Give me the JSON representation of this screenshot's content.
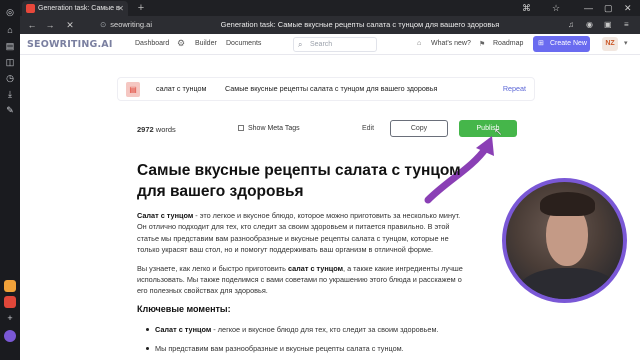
{
  "browser": {
    "tab_title": "Generation task: Самые в",
    "new_tab": "+",
    "url": "seowriting.ai",
    "page_title": "Generation task: Самые вкусные рецепты салата с тунцом для вашего здоровья"
  },
  "app": {
    "logo_main": "SEOWRITING",
    "logo_ai": ".AI",
    "nav": {
      "dashboard": "Dashboard",
      "builder": "Builder",
      "documents": "Documents"
    },
    "search_placeholder": "Search",
    "whats_new": "What's new?",
    "roadmap": "Roadmap",
    "create_new": "Create New",
    "avatar_initials": "NZ"
  },
  "task": {
    "keyword": "салат с тунцом",
    "title": "Самые вкусные рецепты салата с тунцом для вашего здоровья",
    "repeat": "Repeat"
  },
  "toolbar": {
    "word_count": "2972",
    "word_unit": "words",
    "show_meta": "Show Meta Tags",
    "edit": "Edit",
    "copy": "Copy",
    "publish": "Publish"
  },
  "article": {
    "heading": "Самые вкусные рецепты салата с тунцом для вашего здоровья",
    "p1_bold": "Салат с тунцом",
    "p1_line1": " - это легкое и вкусное блюдо, которое можно приготовить за несколько минут.",
    "p1_line2": "Он отлично подходит для тех, кто следит за своим здоровьем и питается правильно. В этой",
    "p1_line3": "статье мы представим вам разнообразные и вкусные рецепты салата с тунцом, которые не",
    "p1_line4": "только украсят ваш стол, но и помогут поддерживать ваш организм в отличной форме.",
    "p2_start": "Вы узнаете, как легко и быстро приготовить ",
    "p2_bold": "салат с тунцом",
    "p2_end": ", а также какие ингредиенты лучше",
    "p2_line2": "использовать. Мы также поделимся с вами советами по украшению этого блюда и расскажем о",
    "p2_line3": "его полезных свойствах для здоровья.",
    "key_moments": "Ключевые моменты:",
    "b1_bold": "Салат с тунцом",
    "b1_rest": " - легкое и вкусное блюдо для тех, кто следит за своим здоровьем.",
    "b2": "Мы представим вам разнообразные и вкусные рецепты салата с тунцом."
  },
  "colors": {
    "accent": "#6a6bf0",
    "publish": "#45b64a",
    "arrow": "#8a3fb5",
    "webcam_ring": "#7a58d6"
  }
}
